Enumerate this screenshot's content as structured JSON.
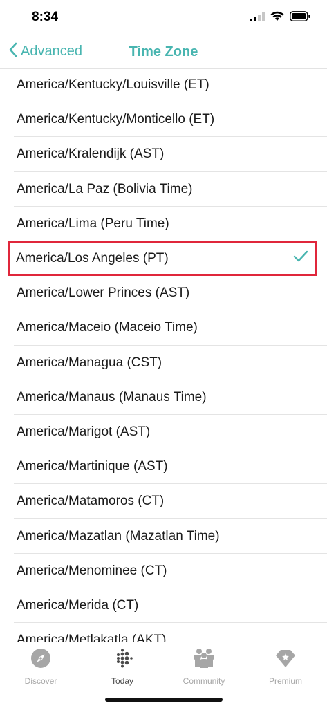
{
  "status_bar": {
    "time": "8:34"
  },
  "nav": {
    "back_label": "Advanced",
    "title": "Time Zone"
  },
  "time_zones": [
    {
      "label": "America/Kentucky/Louisville (ET)",
      "selected": false
    },
    {
      "label": "America/Kentucky/Monticello (ET)",
      "selected": false
    },
    {
      "label": "America/Kralendijk (AST)",
      "selected": false
    },
    {
      "label": "America/La Paz (Bolivia Time)",
      "selected": false
    },
    {
      "label": "America/Lima (Peru Time)",
      "selected": false
    },
    {
      "label": "America/Los Angeles (PT)",
      "selected": true
    },
    {
      "label": "America/Lower Princes (AST)",
      "selected": false
    },
    {
      "label": "America/Maceio (Maceio Time)",
      "selected": false
    },
    {
      "label": "America/Managua (CST)",
      "selected": false
    },
    {
      "label": "America/Manaus (Manaus Time)",
      "selected": false
    },
    {
      "label": "America/Marigot (AST)",
      "selected": false
    },
    {
      "label": "America/Martinique (AST)",
      "selected": false
    },
    {
      "label": "America/Matamoros (CT)",
      "selected": false
    },
    {
      "label": "America/Mazatlan (Mazatlan Time)",
      "selected": false
    },
    {
      "label": "America/Menominee (CT)",
      "selected": false
    },
    {
      "label": "America/Merida (CT)",
      "selected": false
    },
    {
      "label": "America/Metlakatla (AKT)",
      "selected": false
    }
  ],
  "tabs": [
    {
      "label": "Discover",
      "icon": "compass-icon",
      "active": false
    },
    {
      "label": "Today",
      "icon": "fitbit-dots-icon",
      "active": true
    },
    {
      "label": "Community",
      "icon": "community-icon",
      "active": false
    },
    {
      "label": "Premium",
      "icon": "diamond-icon",
      "active": false
    }
  ],
  "colors": {
    "accent": "#48b5b0",
    "highlight_border": "#e0263b",
    "tab_inactive": "#a6a6a6",
    "tab_active": "#4a4a4a"
  }
}
